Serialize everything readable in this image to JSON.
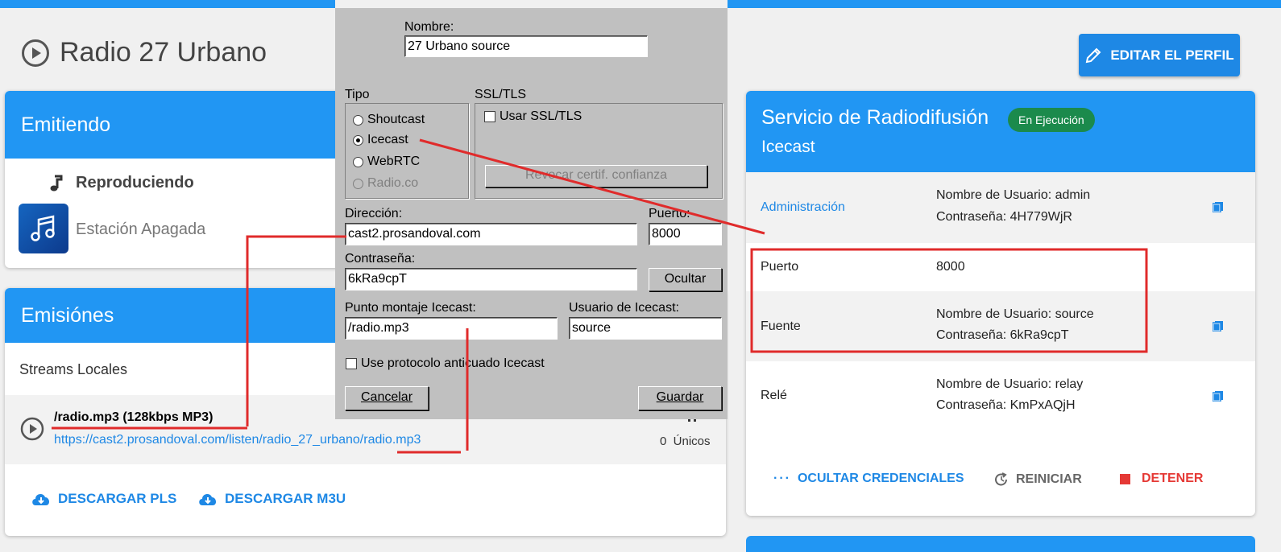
{
  "page": {
    "title": "Radio 27 Urbano",
    "edit_button": "EDITAR EL PERFIL"
  },
  "emitiendo": {
    "header": "Emitiendo",
    "playing_label": "Reproduciendo",
    "station_status": "Estación Apagada"
  },
  "emisiones": {
    "header": "Emisiónes",
    "section": "Streams Locales",
    "stream_name": "/radio.mp3 (128kbps MP3)",
    "stream_url": "https://cast2.prosandoval.com/listen/radio_27_urbano/radio.mp3",
    "listeners_count": "0",
    "uniques": "0  Únicos",
    "download_pls": "DESCARGAR PLS",
    "download_m3u": "DESCARGAR M3U"
  },
  "dialog": {
    "nombre_label": "Nombre:",
    "nombre_value": "27 Urbano source",
    "tipo_label": "Tipo",
    "tipo_options": [
      "Shoutcast",
      "Icecast",
      "WebRTC",
      "Radio.co"
    ],
    "ssl_label": "SSL/TLS",
    "ssl_checkbox": "Usar SSL/TLS",
    "revoke_button": "Revocar certif. confianza",
    "direccion_label": "Dirección:",
    "direccion_value": "cast2.prosandoval.com",
    "puerto_label": "Puerto:",
    "puerto_value": "8000",
    "password_label": "Contraseña:",
    "password_value": "6kRa9cpT",
    "hide_button": "Ocultar",
    "mount_label": "Punto montaje Icecast:",
    "mount_value": "/radio.mp3",
    "user_label": "Usuario de Icecast:",
    "user_value": "source",
    "legacy_checkbox": "Use protocolo anticuado Icecast",
    "cancel_button": "Cancelar",
    "save_button": "Guardar"
  },
  "servicio": {
    "title": "Servicio de Radiodifusión",
    "badge": "En Ejecución",
    "subtitle": "Icecast",
    "rows": [
      {
        "label": "Administración",
        "line1": "Nombre de Usuario: admin",
        "line2": "Contraseña: 4H779WjR"
      },
      {
        "label": "Puerto",
        "line1": "8000",
        "line2": ""
      },
      {
        "label": "Fuente",
        "line1": "Nombre de Usuario: source",
        "line2": "Contraseña: 6kRa9cpT"
      },
      {
        "label": "Relé",
        "line1": "Nombre de Usuario: relay",
        "line2": "Contraseña: KmPxAQjH"
      }
    ],
    "hide_credentials": "OCULTAR CREDENCIALES",
    "restart": "REINICIAR",
    "stop": "DETENER"
  },
  "colors": {
    "primary": "#2196f3",
    "badge": "#1b8a4c",
    "stop": "#e53935",
    "annotation": "#e02b2b"
  }
}
